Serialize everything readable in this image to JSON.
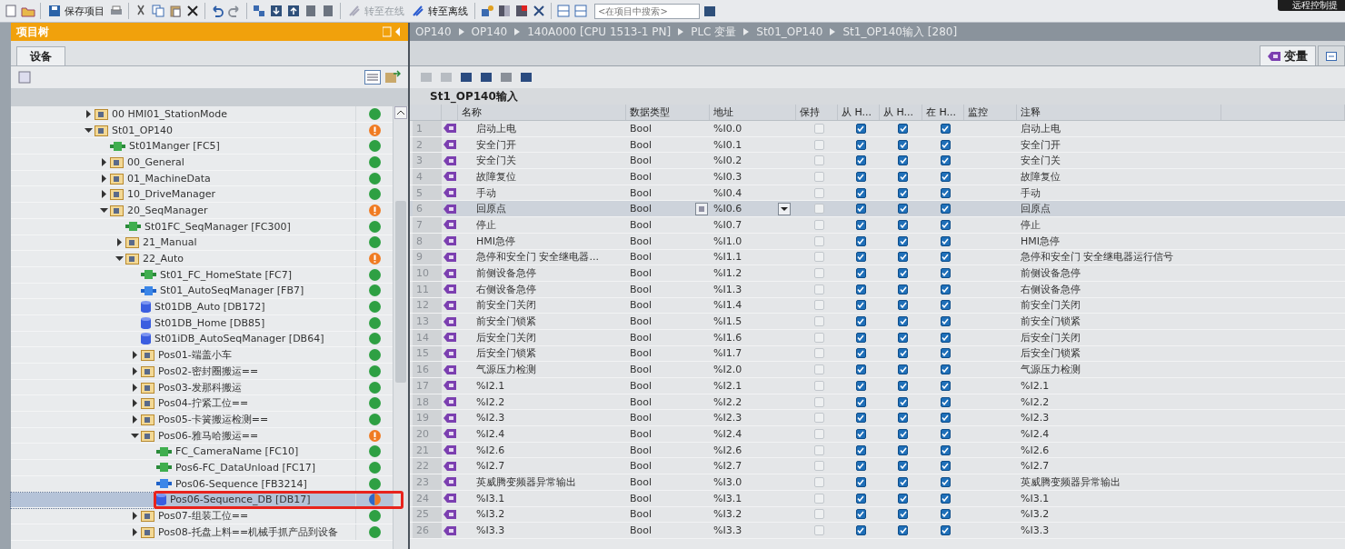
{
  "toolbar": {
    "items": [
      {
        "kind": "new"
      },
      {
        "kind": "open"
      },
      {
        "kind": "save",
        "label": "保存项目"
      },
      {
        "kind": "print"
      },
      {
        "kind": "cut"
      },
      {
        "kind": "copy"
      },
      {
        "kind": "paste"
      },
      {
        "kind": "delete"
      },
      {
        "kind": "undo"
      },
      {
        "kind": "redo"
      },
      {
        "kind": "compile"
      },
      {
        "kind": "download"
      },
      {
        "kind": "upload"
      },
      {
        "kind": "device"
      },
      {
        "kind": "device"
      },
      {
        "kind": "online",
        "label": "转至在线",
        "disabled": true
      },
      {
        "kind": "offline",
        "label": "转至离线",
        "disabled": false
      },
      {
        "kind": "diagnose"
      },
      {
        "kind": "compare"
      },
      {
        "kind": "monitor"
      },
      {
        "kind": "close"
      },
      {
        "kind": "split"
      },
      {
        "kind": "split"
      }
    ],
    "search": {
      "placeholder": "<在项目中搜索>"
    },
    "notice": "远程控制提"
  },
  "project_tree": {
    "title": "项目树",
    "tabs": [
      {
        "label": "设备",
        "selected": true
      }
    ],
    "items": [
      {
        "label": "00 HMI01_StationMode",
        "kind": "folder",
        "expanded": false,
        "color": "#2ea043",
        "warning": false,
        "selected": false
      },
      {
        "label": "St01_OP140",
        "kind": "folder",
        "expanded": true,
        "color": "#f07b22",
        "warning": true,
        "selected": false,
        "children": [
          {
            "label": "St01Manger [FC5]",
            "kind": "fc",
            "color": "#2ea043",
            "warning": false,
            "selected": false
          },
          {
            "label": "00_General",
            "kind": "folder",
            "expanded": false,
            "color": "#2ea043",
            "warning": false,
            "selected": false
          },
          {
            "label": "01_MachineData",
            "kind": "folder",
            "expanded": false,
            "color": "#2ea043",
            "warning": false,
            "selected": false
          },
          {
            "label": "10_DriveManager",
            "kind": "folder",
            "expanded": false,
            "color": "#2ea043",
            "warning": false,
            "selected": false
          },
          {
            "label": "20_SeqManager",
            "kind": "folder",
            "expanded": true,
            "color": "#f07b22",
            "warning": true,
            "selected": false,
            "children": [
              {
                "label": "St01FC_SeqManager [FC300]",
                "kind": "fc",
                "color": "#2ea043",
                "warning": false,
                "selected": false
              },
              {
                "label": "21_Manual",
                "kind": "folder",
                "expanded": false,
                "color": "#2ea043",
                "warning": false,
                "selected": false
              },
              {
                "label": "22_Auto",
                "kind": "folder",
                "expanded": true,
                "color": "#f07b22",
                "warning": true,
                "selected": false,
                "children": [
                  {
                    "label": "St01_FC_HomeState [FC7]",
                    "kind": "fc",
                    "color": "#2ea043",
                    "warning": false,
                    "selected": false
                  },
                  {
                    "label": "St01_AutoSeqManager [FB7]",
                    "kind": "fb",
                    "color": "#2ea043",
                    "warning": false,
                    "selected": false
                  },
                  {
                    "label": "St01DB_Auto [DB172]",
                    "kind": "db",
                    "color": "#2ea043",
                    "warning": false,
                    "selected": false
                  },
                  {
                    "label": "St01DB_Home [DB85]",
                    "kind": "db",
                    "color": "#2ea043",
                    "warning": false,
                    "selected": false
                  },
                  {
                    "label": "St01iDB_AutoSeqManager [DB64]",
                    "kind": "db",
                    "color": "#2ea043",
                    "warning": false,
                    "selected": false
                  },
                  {
                    "label": "Pos01-端盖小车",
                    "kind": "folder",
                    "expanded": false,
                    "color": "#2ea043",
                    "warning": false,
                    "selected": false
                  },
                  {
                    "label": "Pos02-密封圈搬运==",
                    "kind": "folder",
                    "expanded": false,
                    "color": "#2ea043",
                    "warning": false,
                    "selected": false
                  },
                  {
                    "label": "Pos03-发那科搬运",
                    "kind": "folder",
                    "expanded": false,
                    "color": "#2ea043",
                    "warning": false,
                    "selected": false
                  },
                  {
                    "label": "Pos04-拧紧工位==",
                    "kind": "folder",
                    "expanded": false,
                    "color": "#2ea043",
                    "warning": false,
                    "selected": false
                  },
                  {
                    "label": "Pos05-卡簧搬运检测==",
                    "kind": "folder",
                    "expanded": false,
                    "color": "#2ea043",
                    "warning": false,
                    "selected": false
                  },
                  {
                    "label": "Pos06-雅马哈搬运==",
                    "kind": "folder",
                    "expanded": true,
                    "color": "#f07b22",
                    "warning": true,
                    "selected": false,
                    "children": [
                      {
                        "label": "FC_CameraName [FC10]",
                        "kind": "fc",
                        "color": "#2ea043",
                        "warning": false,
                        "selected": false
                      },
                      {
                        "label": "Pos6-FC_DataUnload [FC17]",
                        "kind": "fc",
                        "color": "#2ea043",
                        "warning": false,
                        "selected": false
                      },
                      {
                        "label": "Pos06-Sequence [FB3214]",
                        "kind": "fb",
                        "color": "#2ea043",
                        "warning": false,
                        "selected": false
                      },
                      {
                        "label": "Pos06-Sequence_DB [DB17]",
                        "kind": "db",
                        "color": "#f07b22",
                        "warning": false,
                        "partial": true,
                        "selected": true
                      }
                    ]
                  },
                  {
                    "label": "Pos07-组装工位==",
                    "kind": "folder",
                    "expanded": false,
                    "color": "#2ea043",
                    "warning": false,
                    "selected": false
                  },
                  {
                    "label": "Pos08-托盘上料==机械手抓产品到设备",
                    "kind": "folder",
                    "expanded": false,
                    "color": "#2ea043",
                    "warning": false,
                    "selected": false
                  }
                ]
              }
            ]
          }
        ]
      }
    ]
  },
  "breadcrumb": [
    "OP140",
    "OP140",
    "140A000 [CPU 1513-1 PN]",
    "PLC 变量",
    "St01_OP140",
    "St1_OP140输入 [280]"
  ],
  "editor_tabs": [
    {
      "label": "变量",
      "selected": true
    },
    {
      "selected": false
    }
  ],
  "table": {
    "title": "St1_OP140输入",
    "columns": [
      "名称",
      "数据类型",
      "地址",
      "保持",
      "从 H...",
      "从 H...",
      "在 H...",
      "监控",
      "注释"
    ],
    "rows": [
      {
        "num": "1",
        "name": "启动上电",
        "data_type": "Bool",
        "address": "%I0.0",
        "retain": false,
        "check_1": true,
        "check_2": true,
        "check_3": true,
        "comment": "启动上电",
        "selected": false
      },
      {
        "num": "2",
        "name": "安全门开",
        "data_type": "Bool",
        "address": "%I0.1",
        "retain": false,
        "check_1": true,
        "check_2": true,
        "check_3": true,
        "comment": "安全门开",
        "selected": false
      },
      {
        "num": "3",
        "name": "安全门关",
        "data_type": "Bool",
        "address": "%I0.2",
        "retain": false,
        "check_1": true,
        "check_2": true,
        "check_3": true,
        "comment": "安全门关",
        "selected": false
      },
      {
        "num": "4",
        "name": "故障复位",
        "data_type": "Bool",
        "address": "%I0.3",
        "retain": false,
        "check_1": true,
        "check_2": true,
        "check_3": true,
        "comment": "故障复位",
        "selected": false
      },
      {
        "num": "5",
        "name": "手动",
        "data_type": "Bool",
        "address": "%I0.4",
        "retain": false,
        "check_1": true,
        "check_2": true,
        "check_3": true,
        "comment": "手动",
        "selected": false
      },
      {
        "num": "6",
        "name": "回原点",
        "data_type": "Bool",
        "address": "%I0.6",
        "retain": false,
        "check_1": true,
        "check_2": true,
        "check_3": true,
        "comment": "回原点",
        "selected": true
      },
      {
        "num": "7",
        "name": "停止",
        "data_type": "Bool",
        "address": "%I0.7",
        "retain": false,
        "check_1": true,
        "check_2": true,
        "check_3": true,
        "comment": "停止",
        "selected": false
      },
      {
        "num": "8",
        "name": "HMI急停",
        "data_type": "Bool",
        "address": "%I1.0",
        "retain": false,
        "check_1": true,
        "check_2": true,
        "check_3": true,
        "comment": "HMI急停",
        "selected": false
      },
      {
        "num": "9",
        "name": "急停和安全门 安全继电器...",
        "data_type": "Bool",
        "address": "%I1.1",
        "retain": false,
        "check_1": true,
        "check_2": true,
        "check_3": true,
        "comment": "急停和安全门 安全继电器运行信号",
        "selected": false
      },
      {
        "num": "10",
        "name": "前侧设备急停",
        "data_type": "Bool",
        "address": "%I1.2",
        "retain": false,
        "check_1": true,
        "check_2": true,
        "check_3": true,
        "comment": "前侧设备急停",
        "selected": false
      },
      {
        "num": "11",
        "name": "右侧设备急停",
        "data_type": "Bool",
        "address": "%I1.3",
        "retain": false,
        "check_1": true,
        "check_2": true,
        "check_3": true,
        "comment": "右侧设备急停",
        "selected": false
      },
      {
        "num": "12",
        "name": "前安全门关闭",
        "data_type": "Bool",
        "address": "%I1.4",
        "retain": false,
        "check_1": true,
        "check_2": true,
        "check_3": true,
        "comment": "前安全门关闭",
        "selected": false
      },
      {
        "num": "13",
        "name": "前安全门锁紧",
        "data_type": "Bool",
        "address": "%I1.5",
        "retain": false,
        "check_1": true,
        "check_2": true,
        "check_3": true,
        "comment": "前安全门锁紧",
        "selected": false
      },
      {
        "num": "14",
        "name": "后安全门关闭",
        "data_type": "Bool",
        "address": "%I1.6",
        "retain": false,
        "check_1": true,
        "check_2": true,
        "check_3": true,
        "comment": "后安全门关闭",
        "selected": false
      },
      {
        "num": "15",
        "name": "后安全门锁紧",
        "data_type": "Bool",
        "address": "%I1.7",
        "retain": false,
        "check_1": true,
        "check_2": true,
        "check_3": true,
        "comment": "后安全门锁紧",
        "selected": false
      },
      {
        "num": "16",
        "name": "气源压力检测",
        "data_type": "Bool",
        "address": "%I2.0",
        "retain": false,
        "check_1": true,
        "check_2": true,
        "check_3": true,
        "comment": "气源压力检测",
        "selected": false
      },
      {
        "num": "17",
        "name": "%I2.1",
        "data_type": "Bool",
        "address": "%I2.1",
        "retain": false,
        "check_1": true,
        "check_2": true,
        "check_3": true,
        "comment": "%I2.1",
        "selected": false
      },
      {
        "num": "18",
        "name": "%I2.2",
        "data_type": "Bool",
        "address": "%I2.2",
        "retain": false,
        "check_1": true,
        "check_2": true,
        "check_3": true,
        "comment": "%I2.2",
        "selected": false
      },
      {
        "num": "19",
        "name": "%I2.3",
        "data_type": "Bool",
        "address": "%I2.3",
        "retain": false,
        "check_1": true,
        "check_2": true,
        "check_3": true,
        "comment": "%I2.3",
        "selected": false
      },
      {
        "num": "20",
        "name": "%I2.4",
        "data_type": "Bool",
        "address": "%I2.4",
        "retain": false,
        "check_1": true,
        "check_2": true,
        "check_3": true,
        "comment": "%I2.4",
        "selected": false
      },
      {
        "num": "21",
        "name": "%I2.6",
        "data_type": "Bool",
        "address": "%I2.6",
        "retain": false,
        "check_1": true,
        "check_2": true,
        "check_3": true,
        "comment": "%I2.6",
        "selected": false
      },
      {
        "num": "22",
        "name": "%I2.7",
        "data_type": "Bool",
        "address": "%I2.7",
        "retain": false,
        "check_1": true,
        "check_2": true,
        "check_3": true,
        "comment": "%I2.7",
        "selected": false
      },
      {
        "num": "23",
        "name": "英威腾变频器异常输出",
        "data_type": "Bool",
        "address": "%I3.0",
        "retain": false,
        "check_1": true,
        "check_2": true,
        "check_3": true,
        "comment": "英威腾变频器异常输出",
        "selected": false
      },
      {
        "num": "24",
        "name": "%I3.1",
        "data_type": "Bool",
        "address": "%I3.1",
        "retain": false,
        "check_1": true,
        "check_2": true,
        "check_3": true,
        "comment": "%I3.1",
        "selected": false
      },
      {
        "num": "25",
        "name": "%I3.2",
        "data_type": "Bool",
        "address": "%I3.2",
        "retain": false,
        "check_1": true,
        "check_2": true,
        "check_3": true,
        "comment": "%I3.2",
        "selected": false
      },
      {
        "num": "26",
        "name": "%I3.3",
        "data_type": "Bool",
        "address": "%I3.3",
        "retain": false,
        "check_1": true,
        "check_2": true,
        "check_3": true,
        "comment": "%I3.3",
        "selected": false
      }
    ]
  }
}
